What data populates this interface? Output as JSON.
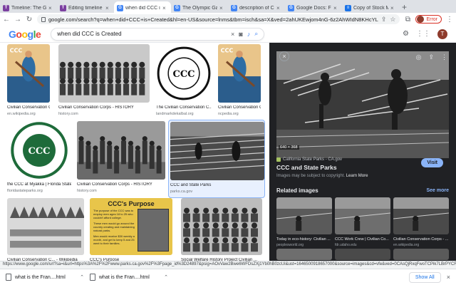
{
  "tabs": [
    {
      "title": "Timeline: The Great",
      "icon": "timeline-favicon",
      "color": "#7b3fa0",
      "glyph": "T",
      "active": false
    },
    {
      "title": "Editing timeline grea",
      "icon": "timeline-favicon",
      "color": "#7b3fa0",
      "glyph": "T",
      "active": false
    },
    {
      "title": "when did CCC is Cre",
      "icon": "google-favicon",
      "color": "#4285f4",
      "glyph": "G",
      "active": true
    },
    {
      "title": "The Olympic Games",
      "icon": "google-favicon",
      "color": "#4285f4",
      "glyph": "G",
      "active": false
    },
    {
      "title": "description of CCC i",
      "icon": "google-favicon",
      "color": "#4285f4",
      "glyph": "G",
      "active": false
    },
    {
      "title": "Google Docs: Free O",
      "icon": "google-favicon",
      "color": "#4285f4",
      "glyph": "G",
      "active": false
    },
    {
      "title": "Copy of Stock Marke",
      "icon": "docs-favicon",
      "color": "#1a73e8",
      "glyph": "≡",
      "active": false
    }
  ],
  "tab_close": "×",
  "new_tab": "+",
  "address": {
    "url": "google.com/search?q=when+did+CCC+is+Created&hl=en-US&source=lnms&tbm=isch&sa=X&ved=2ahUKEwjom4nG-6z2AhWIdN8KHcYLCxUQ_AUoA3oECAIQB..."
  },
  "profile": {
    "error_label": "Error",
    "avatar_letter": "T"
  },
  "search": {
    "query": "when did CCC is Created",
    "logo": [
      "G",
      "o",
      "o",
      "g",
      "l",
      "e"
    ]
  },
  "results": [
    {
      "title": "Civilian Conservation C...",
      "source": "en.wikipedia.org",
      "art": "poster"
    },
    {
      "title": "Civilian Conservation Corps - HISTORY",
      "source": "history.com",
      "art": "crowd"
    },
    {
      "title": "The Civilian Conservation C...",
      "source": "landmarkdekalbal.org",
      "art": "seal-bw"
    },
    {
      "title": "Civilian Conservation C...",
      "source": "ncpedia.org",
      "art": "poster"
    },
    {
      "title": "the CCC at Myakka | Florida State ...",
      "source": "floridastateparks.org",
      "art": "seal-green"
    },
    {
      "title": "Civilian Conservation Corps - HISTORY",
      "source": "history.com",
      "art": "march"
    },
    {
      "title": "CCC and State Parks",
      "source": "parks.ca.gov",
      "art": "logs"
    },
    {
      "title": "Civilian Conservation C... - Wikipedia",
      "source": "",
      "art": "camp"
    },
    {
      "title": "CCC's Purpose",
      "source": "",
      "art": "purpose"
    },
    {
      "title": "Social Welfare History Project Civilian ...",
      "source": "",
      "art": "group"
    }
  ],
  "purpose_card": {
    "heading": "CCC's Purpose",
    "bullets": [
      "The purpose of the CCC was to employ men ages 18 to 25 who couldn't afford college.",
      "These men would go around the country creating and maintaining natural parks.",
      "Men would receive $30 weekly a month, and get to keep 5 and 25 went to their families."
    ]
  },
  "preview": {
    "dims": "640 × 368",
    "site": "California State Parks - CA.gov",
    "title": "CCC and State Parks",
    "visit": "Visit",
    "notice_prefix": "Images may be subject to copyright.",
    "learn_more": "Learn More",
    "related_heading": "Related images",
    "see_more": "See more",
    "related": [
      {
        "title": "Today in eco-history: Civilian ...",
        "source": "peoplesworld.org"
      },
      {
        "title": "CCC Work Crew | Civilian Co...",
        "source": "fdr.udaho.edu"
      },
      {
        "title": "Civilian Conservation Corps - ...",
        "source": "en.wikipedia.org"
      }
    ]
  },
  "statusbar": {
    "url": "https://www.google.com/url?sa=i&url=https%3A%2F%2Fwww.parks.ca.gov%2F%3Fpage_id%3D24897&psig=AOvVaw2Bwe6WFDsZXj1Yb0hB0zcUi&ust=1646500918657000&source=images&cd=vfe&ved=0CAsQjRxqFwoTCPik7LBrPYCFQAAAA..."
  },
  "downloads": {
    "items": [
      "what is the Fran....html",
      "what is the Fran....html"
    ],
    "show_all": "Show All",
    "close": "×"
  },
  "colors": {
    "accent": "#1a73e8",
    "preview_bg": "#202124",
    "error": "#d93025"
  }
}
